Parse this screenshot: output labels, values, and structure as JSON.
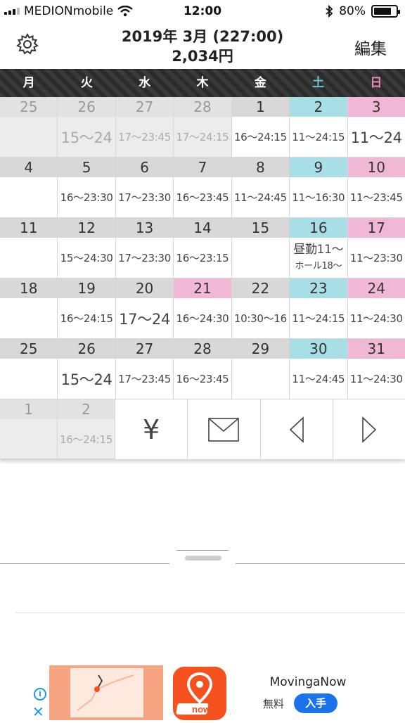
{
  "status_bar": {
    "carrier": "MEDIONmobile",
    "time": "12:00",
    "battery": "80%",
    "battery_level": 0.8
  },
  "header": {
    "title_line1": "2019年 3月 (227:00)",
    "title_line2": "2,034円",
    "edit_label": "編集"
  },
  "weekdays": [
    "月",
    "火",
    "水",
    "木",
    "金",
    "土",
    "日"
  ],
  "weeks": [
    [
      {
        "day": "25",
        "shift": "",
        "type": "other"
      },
      {
        "day": "26",
        "shift": "15〜24",
        "type": "other",
        "big": true
      },
      {
        "day": "27",
        "shift": "17〜23:45",
        "type": "other"
      },
      {
        "day": "28",
        "shift": "17〜24:15",
        "type": "other"
      },
      {
        "day": "1",
        "shift": "16〜24:15",
        "type": "weekday"
      },
      {
        "day": "2",
        "shift": "11〜24:15",
        "type": "sat"
      },
      {
        "day": "3",
        "shift": "11〜24",
        "type": "sun",
        "big": true
      }
    ],
    [
      {
        "day": "4",
        "shift": "",
        "type": "weekday"
      },
      {
        "day": "5",
        "shift": "16〜23:30",
        "type": "weekday"
      },
      {
        "day": "6",
        "shift": "17〜23:30",
        "type": "weekday"
      },
      {
        "day": "7",
        "shift": "16〜23:45",
        "type": "weekday"
      },
      {
        "day": "8",
        "shift": "11〜24:45",
        "type": "weekday"
      },
      {
        "day": "9",
        "shift": "11〜16:30",
        "type": "sat"
      },
      {
        "day": "10",
        "shift": "11〜23:45",
        "type": "sun"
      }
    ],
    [
      {
        "day": "11",
        "shift": "",
        "type": "weekday"
      },
      {
        "day": "12",
        "shift": "15〜24:30",
        "type": "weekday"
      },
      {
        "day": "13",
        "shift": "17〜23:30",
        "type": "weekday"
      },
      {
        "day": "14",
        "shift": "16〜23:15",
        "type": "weekday"
      },
      {
        "day": "15",
        "shift": "",
        "type": "weekday"
      },
      {
        "day": "16",
        "shift": "昼勤11〜",
        "shift2": "ホール18〜",
        "type": "sat"
      },
      {
        "day": "17",
        "shift": "11〜23:30",
        "type": "sun"
      }
    ],
    [
      {
        "day": "18",
        "shift": "",
        "type": "weekday"
      },
      {
        "day": "19",
        "shift": "16〜24:15",
        "type": "weekday"
      },
      {
        "day": "20",
        "shift": "17〜24",
        "type": "weekday",
        "big": true
      },
      {
        "day": "21",
        "shift": "16〜24:30",
        "type": "hol"
      },
      {
        "day": "22",
        "shift": "10:30〜16",
        "type": "weekday"
      },
      {
        "day": "23",
        "shift": "11〜24:15",
        "type": "sat"
      },
      {
        "day": "24",
        "shift": "11〜24:30",
        "type": "sun"
      }
    ],
    [
      {
        "day": "25",
        "shift": "",
        "type": "weekday"
      },
      {
        "day": "26",
        "shift": "15〜24",
        "type": "weekday",
        "big": true
      },
      {
        "day": "27",
        "shift": "17〜23:45",
        "type": "weekday"
      },
      {
        "day": "28",
        "shift": "16〜23:45",
        "type": "weekday"
      },
      {
        "day": "29",
        "shift": "",
        "type": "weekday"
      },
      {
        "day": "30",
        "shift": "11〜24:45",
        "type": "sat"
      },
      {
        "day": "31",
        "shift": "11〜24:30",
        "type": "sun"
      }
    ]
  ],
  "last_row": [
    {
      "day": "1",
      "shift": "",
      "type": "other"
    },
    {
      "day": "2",
      "shift": "16〜24:15",
      "type": "other"
    }
  ],
  "toolbar": {
    "yen_symbol": "¥"
  },
  "ad": {
    "app_name": "MovingaNow",
    "price": "無料",
    "get_label": "入手",
    "icon_text": "now",
    "info_glyph": "i",
    "close_glyph": "✕"
  },
  "colors": {
    "saturday": "#a8dfe7",
    "sunday_holiday": "#f0b8d5",
    "weekday_header": "#d8d8d8",
    "other_month": "#ececec"
  }
}
